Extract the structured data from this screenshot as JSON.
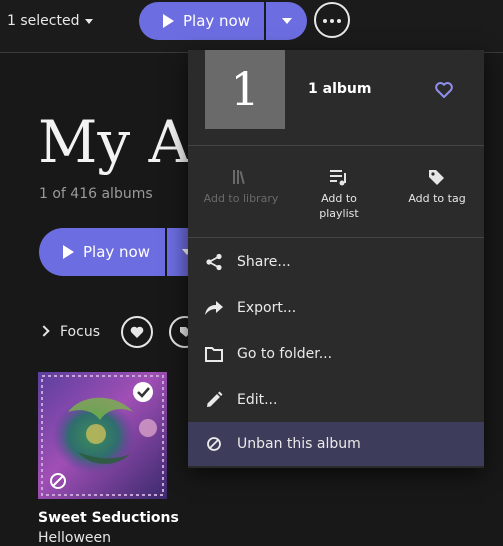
{
  "topbar": {
    "selection_label": "1 selected",
    "play_label": "Play now"
  },
  "page": {
    "title": "My Albums",
    "count": "1 of 416 albums",
    "play_label": "Play now",
    "focus_label": "Focus"
  },
  "album": {
    "name": "Sweet Seductions",
    "artist": "Helloween"
  },
  "menu": {
    "thumb_text": "1",
    "album_count": "1 album",
    "actions": [
      {
        "label": "Add to library",
        "enabled": false,
        "icon": "library-icon"
      },
      {
        "label": "Add to playlist",
        "enabled": true,
        "icon": "playlist-add-icon"
      },
      {
        "label": "Add to tag",
        "enabled": true,
        "icon": "tag-icon"
      }
    ],
    "items": [
      {
        "label": "Share...",
        "icon": "share-icon"
      },
      {
        "label": "Export...",
        "icon": "export-icon"
      },
      {
        "label": "Go to folder...",
        "icon": "folder-icon"
      },
      {
        "label": "Edit...",
        "icon": "edit-icon"
      },
      {
        "label": "Unban this album",
        "icon": "ban-icon",
        "highlighted": true
      }
    ]
  },
  "colors": {
    "accent": "#6c6de0",
    "background": "#181818",
    "menu_bg": "#2b2b2b",
    "menu_highlight": "#3d3c5b",
    "heart": "#8f8ff0"
  }
}
